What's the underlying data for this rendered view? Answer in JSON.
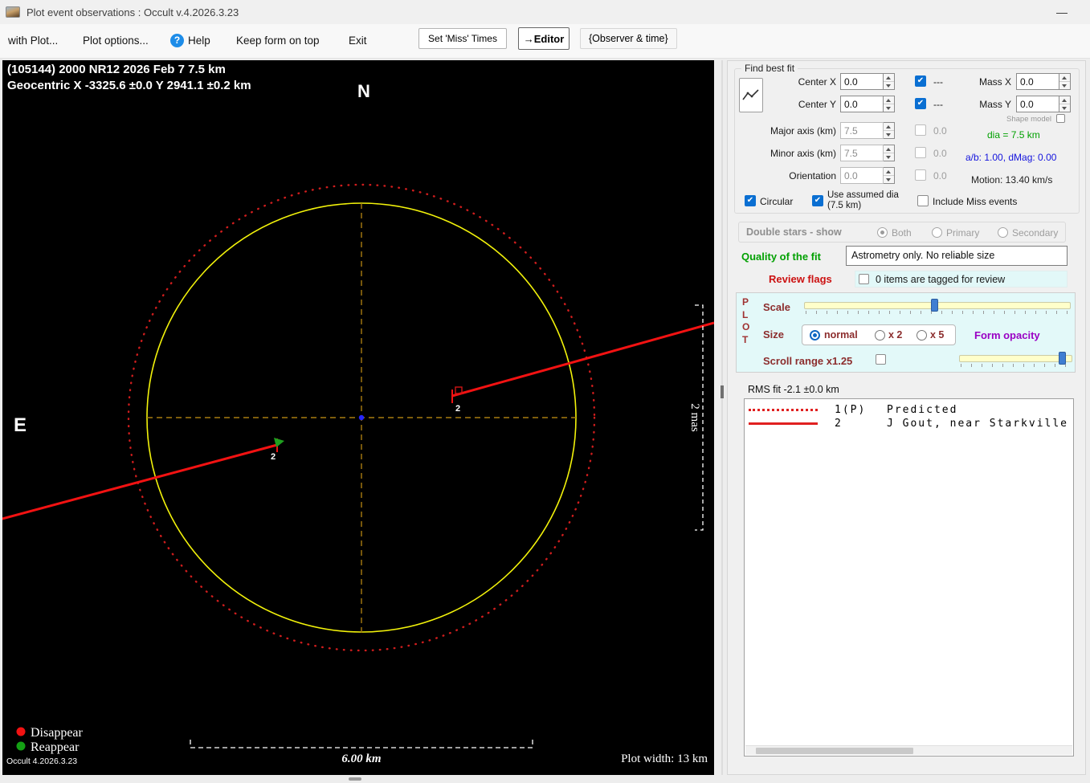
{
  "window": {
    "title": "Plot event observations : Occult v.4.2026.3.23",
    "minimize_glyph": "—"
  },
  "icons": {
    "help_glyph": "?",
    "chevron_down": "⌄",
    "check_glyph": "✔"
  },
  "menu": {
    "with_plot": "with Plot...",
    "plot_options": "Plot options...",
    "help": "Help",
    "keep_on_top": "Keep form on top",
    "exit": "Exit",
    "set_miss_times": "Set 'Miss' Times",
    "editor": "→Editor",
    "observer_time": "{Observer & time}"
  },
  "plot": {
    "header_line1": "(105144) 2000 NR12  2026 Feb 7   7.5 km",
    "header_line2": "Geocentric  X  -3325.6 ±0.0  Y 2941.1 ±0.2 km",
    "north_label": "N",
    "east_label": "E",
    "mas_scale_label": "2 mas",
    "km_scale_label": "6.00 km",
    "plot_width_label": "Plot width: 13 km",
    "disappear_label": "Disappear",
    "reappear_label": "Reappear",
    "version_label": "Occult 4.2026.3.23",
    "chord2_label_right": "2",
    "chord2_label_left": "2"
  },
  "find_best_fit": {
    "title": "Find best fit",
    "center_x": {
      "label": "Center X",
      "value": "0.0"
    },
    "center_y": {
      "label": "Center Y",
      "value": "0.0"
    },
    "center_x_dash": "---",
    "center_y_dash": "---",
    "mass_x": {
      "label": "Mass X",
      "value": "0.0"
    },
    "mass_y": {
      "label": "Mass Y",
      "value": "0.0"
    },
    "shape_model_label": "Shape model",
    "major_axis": {
      "label": "Major axis (km)",
      "value": "7.5",
      "check_value": "0.0"
    },
    "minor_axis": {
      "label": "Minor axis (km)",
      "value": "7.5",
      "check_value": "0.0"
    },
    "orientation": {
      "label": "Orientation",
      "value": "0.0",
      "check_value": "0.0"
    },
    "dia_text": "dia = 7.5 km",
    "ab_dmag_text": "a/b: 1.00, dMag: 0.00",
    "motion_text": "Motion: 13.40 km/s",
    "circular_label": "Circular",
    "use_assumed_label": "Use assumed dia (7.5 km)",
    "include_miss_label": "Include Miss events"
  },
  "double_stars": {
    "label": "Double stars - show",
    "options": [
      "Both",
      "Primary",
      "Secondary"
    ],
    "selected": "Both"
  },
  "quality": {
    "label": "Quality of the fit",
    "value": "Astrometry only. No reliable size"
  },
  "review_flags": {
    "label": "Review flags",
    "text": "0 items are tagged for review"
  },
  "plot_controls": {
    "side_label": "PLOT",
    "scale_label": "Scale",
    "size_label": "Size",
    "size_options": [
      "normal",
      "x 2",
      "x 5"
    ],
    "size_selected": "normal",
    "form_opacity_label": "Form opacity",
    "scroll_range_label": "Scroll range x1.25"
  },
  "rms_text": "RMS fit -2.1 ±0.0 km",
  "observations": {
    "rows": [
      {
        "id": "1(P)",
        "name": "Predicted",
        "style": "dotted"
      },
      {
        "id": "2",
        "name": "J Gout, near Starkville",
        "style": "solid"
      }
    ]
  }
}
